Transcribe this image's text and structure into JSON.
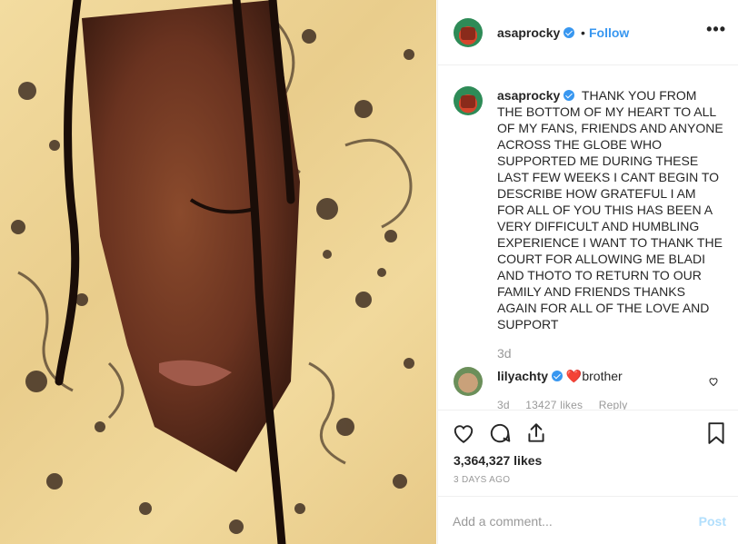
{
  "post": {
    "author": "asaprocky",
    "separator": "•",
    "follow_label": "Follow",
    "more_label": "•••"
  },
  "caption": {
    "username": "asaprocky",
    "text": "THANK YOU FROM THE BOTTOM OF MY HEART TO ALL OF MY FANS, FRIENDS AND ANYONE ACROSS THE GLOBE WHO SUPPORTED ME DURING THESE LAST FEW WEEKS I CANT BEGIN TO DESCRIBE HOW GRATEFUL I AM FOR ALL OF YOU THIS HAS BEEN A VERY DIFFICULT AND HUMBLING EXPERIENCE I WANT TO THANK THE COURT FOR ALLOWING ME BLADI AND THOTO TO RETURN TO OUR FAMILY AND FRIENDS THANKS AGAIN FOR ALL OF THE LOVE AND SUPPORT",
    "time": "3d"
  },
  "comment": {
    "username": "lilyachty",
    "heart": "❤️",
    "text": "brother",
    "time": "3d",
    "likes": "13427 likes",
    "reply": "Reply"
  },
  "stats": {
    "likes": "3,364,327 likes",
    "date": "3 DAYS AGO"
  },
  "composer": {
    "placeholder": "Add a comment...",
    "post_label": "Post"
  },
  "icons": [
    "heart-icon",
    "comment-icon",
    "share-icon",
    "bookmark-icon",
    "verified-icon",
    "more-icon"
  ],
  "colors": {
    "link": "#3897f0",
    "verified": "#3897f0",
    "post_disabled": "#b2dffc",
    "muted": "#999999"
  }
}
